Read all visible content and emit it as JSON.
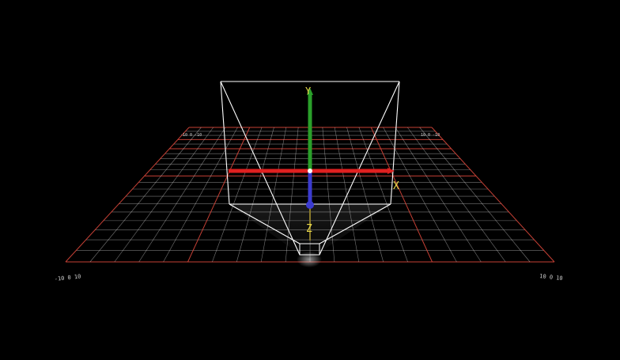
{
  "colors": {
    "background": "#000000",
    "grid_minor": "#d8d8d8",
    "grid_major": "#d8463a",
    "frustum": "#ffffff",
    "axis_x": "#e02020",
    "axis_y": "#2aa02a",
    "axis_z": "#3b3bd0",
    "axis_label": "#e8d84a",
    "corner_label": "#cfcfcf"
  },
  "axes": {
    "x_label": "X",
    "y_label": "Y",
    "z_label": "Z"
  },
  "corner_labels": {
    "back_left": "-10 0 -10",
    "back_right": "10 0 -10",
    "front_left": "-10 0 10",
    "front_right": "10 0 10"
  }
}
